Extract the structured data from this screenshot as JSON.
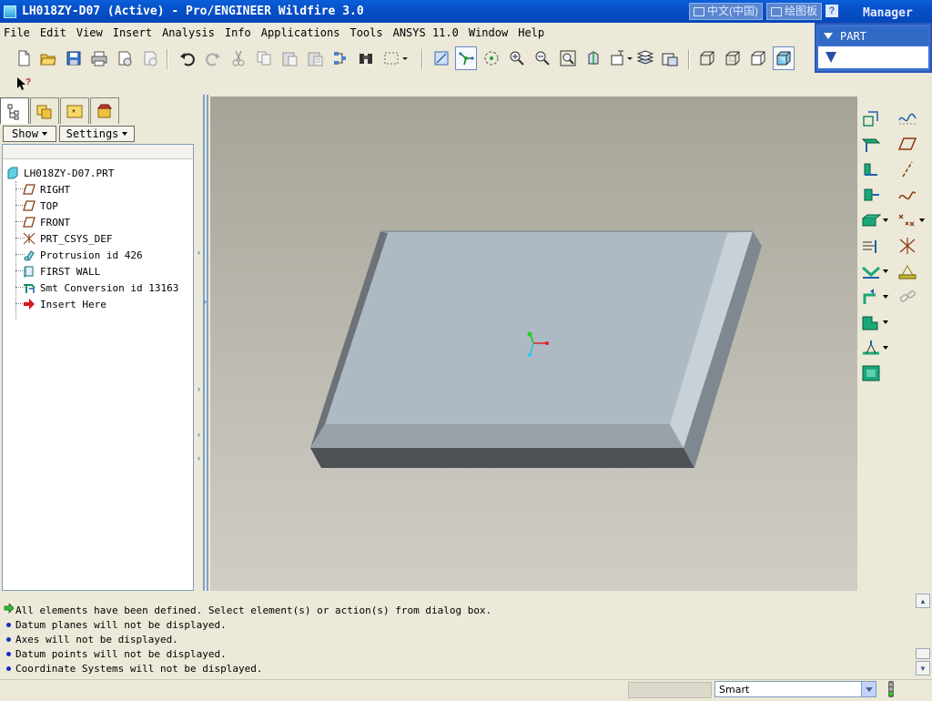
{
  "window": {
    "title": "LH018ZY-D07 (Active) - Pro/ENGINEER Wildfire 3.0",
    "ime_lang": "中文(中国)",
    "ime_board": "绘图板",
    "ime_help": "?",
    "layer_manager_title": "Manager"
  },
  "menu": [
    "File",
    "Edit",
    "View",
    "Insert",
    "Analysis",
    "Info",
    "Applications",
    "Tools",
    "ANSYS 11.0",
    "Window",
    "Help"
  ],
  "layer_panel": {
    "part_label": "PART"
  },
  "left_panel": {
    "show_label": "Show",
    "settings_label": "Settings"
  },
  "model_tree": {
    "root": "LH018ZY-D07.PRT",
    "items": [
      {
        "label": "RIGHT",
        "icon": "datum-plane-icon"
      },
      {
        "label": "TOP",
        "icon": "datum-plane-icon"
      },
      {
        "label": "FRONT",
        "icon": "datum-plane-icon"
      },
      {
        "label": "PRT_CSYS_DEF",
        "icon": "csys-icon"
      },
      {
        "label": "Protrusion id 426",
        "icon": "protrusion-icon"
      },
      {
        "label": "FIRST WALL",
        "icon": "first-wall-icon"
      },
      {
        "label": "Smt Conversion id 13163",
        "icon": "smt-conversion-icon"
      },
      {
        "label": "Insert Here",
        "icon": "insert-arrow-icon"
      }
    ]
  },
  "messages": [
    {
      "text": "All elements have been defined. Select element(s) or action(s) from dialog box.",
      "type": "prompt"
    },
    {
      "text": "Datum planes will not be displayed.",
      "type": "info"
    },
    {
      "text": "Axes will not be displayed.",
      "type": "info"
    },
    {
      "text": "Datum points will not be displayed.",
      "type": "info"
    },
    {
      "text": "Coordinate Systems will not be displayed.",
      "type": "info"
    }
  ],
  "status": {
    "filter_value": "Smart"
  },
  "colors": {
    "titlebar": "#0650c8",
    "desktop": "#ece9d8",
    "model_face": "#aeb9c2",
    "model_edge": "#5a5f64",
    "accent": "#316ac5"
  }
}
